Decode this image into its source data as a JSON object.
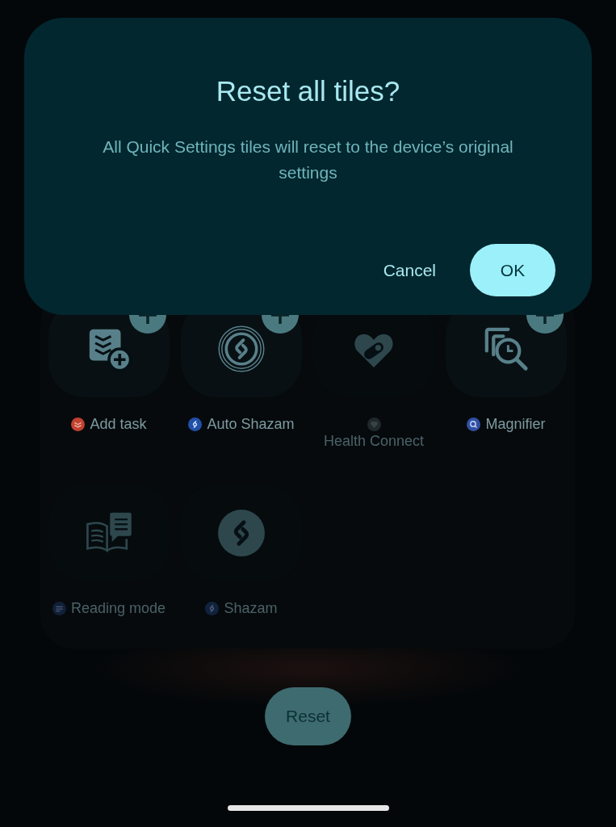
{
  "dialog": {
    "title": "Reset all tiles?",
    "message": "All Quick Settings tiles will reset to the device’s original settings",
    "buttons": [
      {
        "label": "Cancel",
        "kind": "text"
      },
      {
        "label": "OK",
        "kind": "filled"
      }
    ]
  },
  "tiles": [
    {
      "label": "Add task",
      "add_badge": true,
      "dimmed": false
    },
    {
      "label": "Auto Shazam",
      "add_badge": true,
      "dimmed": false
    },
    {
      "label": "Health Connect",
      "add_badge": false,
      "dimmed": true
    },
    {
      "label": "Magnifier",
      "add_badge": true,
      "dimmed": false
    },
    {
      "label": "Reading mode",
      "add_badge": false,
      "dimmed": true
    },
    {
      "label": "Shazam",
      "add_badge": false,
      "dimmed": true
    }
  ],
  "reset_button": {
    "label": "Reset"
  }
}
